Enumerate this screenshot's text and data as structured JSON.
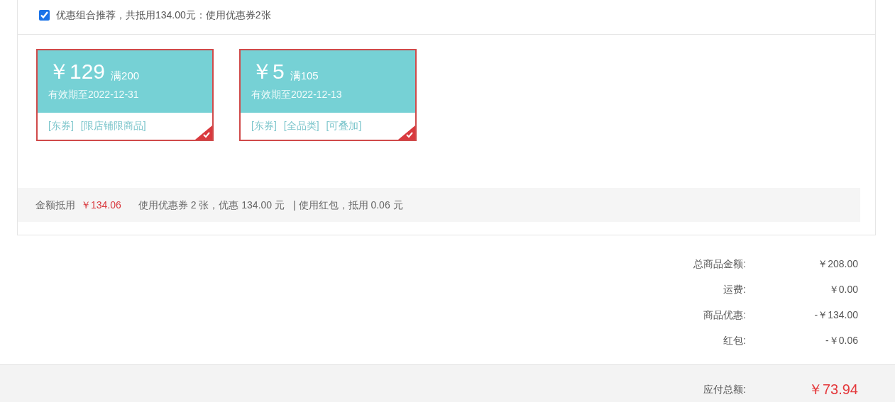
{
  "recommendation": {
    "checked": true,
    "label": "优惠组合推荐，共抵用134.00元：使用优惠券2张"
  },
  "coupons": [
    {
      "amount": "￥129",
      "threshold": "满200",
      "validity": "有效期至2022-12-31",
      "tags": [
        "[东券]",
        "[限店铺限商品]"
      ],
      "selected": true
    },
    {
      "amount": "￥5",
      "threshold": "满105",
      "validity": "有效期至2022-12-13",
      "tags": [
        "[东券]",
        "[全品类]",
        "[可叠加]"
      ],
      "selected": true
    }
  ],
  "deduction": {
    "label": "金额抵用",
    "amount": "￥134.06",
    "coupon_note": "使用优惠券 2 张，优惠 134.00 元",
    "red_packet_note": "| 使用红包，抵用 0.06 元"
  },
  "summary": [
    {
      "label": "总商品金额:",
      "value": "￥208.00"
    },
    {
      "label": "运费:",
      "value": "￥0.00"
    },
    {
      "label": "商品优惠:",
      "value": "-￥134.00"
    },
    {
      "label": "红包:",
      "value": "-￥0.06"
    }
  ],
  "total": {
    "label": "应付总额:",
    "value": "￥73.94"
  }
}
